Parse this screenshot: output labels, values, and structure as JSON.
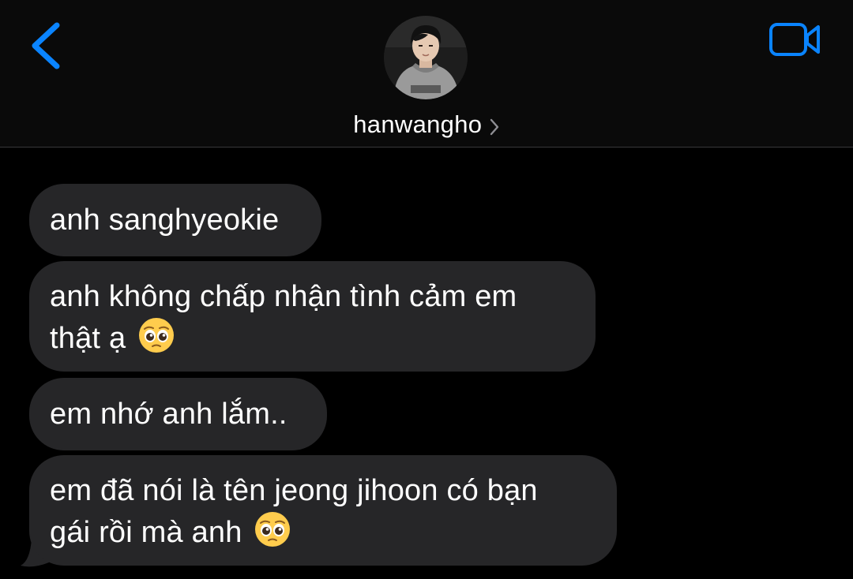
{
  "header": {
    "contact_name": "hanwangho",
    "back_icon": "chevron-left-icon",
    "video_icon": "video-camera-icon",
    "accent_color": "#0a84ff"
  },
  "messages": [
    {
      "line1": "anh sanghyeokie",
      "line2": ""
    },
    {
      "line1": "anh không chấp nhận tình cảm em",
      "line2": "thật ạ",
      "emoji": "pleading-face-emoji"
    },
    {
      "line1": "em nhớ anh lắm..",
      "line2": ""
    },
    {
      "line1": "em đã nói là tên jeong jihoon có bạn",
      "line2": "gái rồi mà anh",
      "emoji": "pleading-face-emoji"
    }
  ],
  "colors": {
    "background": "#000000",
    "bubble": "#262628",
    "text": "#ffffff",
    "divider": "#38383a"
  }
}
